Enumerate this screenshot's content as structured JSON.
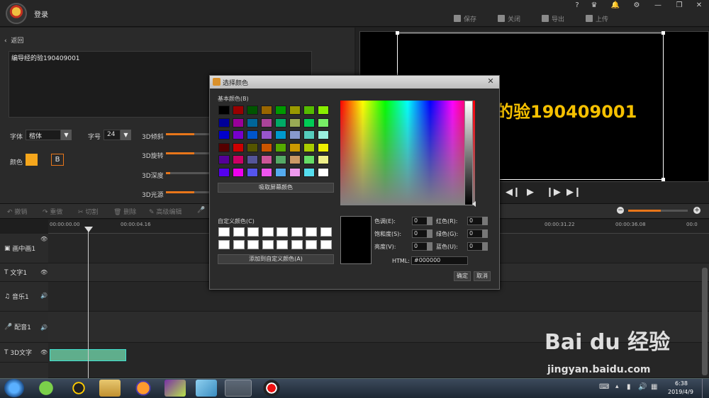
{
  "header": {
    "login": "登录",
    "actions": [
      {
        "label": "保存",
        "icon": "save-icon"
      },
      {
        "label": "关闭",
        "icon": "close-doc-icon"
      },
      {
        "label": "导出",
        "icon": "export-icon"
      },
      {
        "label": "上传",
        "icon": "upload-icon"
      }
    ],
    "window": [
      "?",
      "▾",
      "▴",
      "⚙",
      "—",
      "❐",
      "✕"
    ]
  },
  "editor": {
    "back": "返回",
    "text": "编导经的验190409001",
    "font_label": "字体",
    "font_value": "楷体",
    "size_label": "字号",
    "size_value": "24",
    "color_label": "颜色",
    "color_value": "#f5a61c",
    "bold_label": "B",
    "sliders": [
      {
        "label": "3D倾斜",
        "value": 0.65
      },
      {
        "label": "3D旋转",
        "value": 0.65
      },
      {
        "label": "3D深度",
        "value": 0.1
      },
      {
        "label": "3D光源",
        "value": 0.65
      }
    ]
  },
  "preview": {
    "overlay": "的验190409001"
  },
  "timeline": {
    "tools": [
      "撤销",
      "重做",
      "切割",
      "删除",
      "高级编辑"
    ],
    "ticks": [
      "00:00:00.00",
      "00:00:04.16",
      "00:00:31.22",
      "00:00:36.08",
      "00:0"
    ],
    "tracks": [
      "画中画1",
      "文字1",
      "音乐1",
      "配音1",
      "3D文字"
    ],
    "zoom": 0.55
  },
  "dialog": {
    "title": "选择颜色",
    "basic_label": "基本颜色(B)",
    "basic_colors": [
      "#000000",
      "#990000",
      "#005500",
      "#996600",
      "#009900",
      "#999900",
      "#55bb00",
      "#88ee00",
      "#000099",
      "#990099",
      "#006699",
      "#aa4499",
      "#00aa66",
      "#99aa55",
      "#00cc55",
      "#77ee66",
      "#0000cc",
      "#7700cc",
      "#0055cc",
      "#9955cc",
      "#0099cc",
      "#8899cc",
      "#55ccbb",
      "#99eedd",
      "#550000",
      "#cc0000",
      "#555500",
      "#cc5500",
      "#55aa00",
      "#cc9900",
      "#aacc00",
      "#eeee00",
      "#550099",
      "#cc0066",
      "#555599",
      "#cc5599",
      "#55aa66",
      "#cc9966",
      "#66dd66",
      "#eeee88",
      "#5500ee",
      "#ee00ee",
      "#5555ee",
      "#ee55ee",
      "#55aaee",
      "#ee99ee",
      "#55ddee",
      "#ffffff"
    ],
    "pick_screen": "吸取屏幕颜色",
    "custom_label": "自定义颜色(C)",
    "custom_count": 16,
    "add_custom": "添加到自定义颜色(A)",
    "fields_left": [
      {
        "label": "色调(E):",
        "value": "0"
      },
      {
        "label": "饱和度(S):",
        "value": "0"
      },
      {
        "label": "亮度(V):",
        "value": "0"
      }
    ],
    "fields_right": [
      {
        "label": "红色(R):",
        "value": "0"
      },
      {
        "label": "绿色(G):",
        "value": "0"
      },
      {
        "label": "蓝色(U):",
        "value": "0"
      }
    ],
    "html_label": "HTML:",
    "html_value": "#000000",
    "ok": "确定",
    "cancel": "取消"
  },
  "taskbar": {
    "time": "6:38",
    "date": "2019/4/9"
  },
  "watermark": {
    "brand": "Bai du 经验",
    "url": "jingyan.baidu.com"
  }
}
